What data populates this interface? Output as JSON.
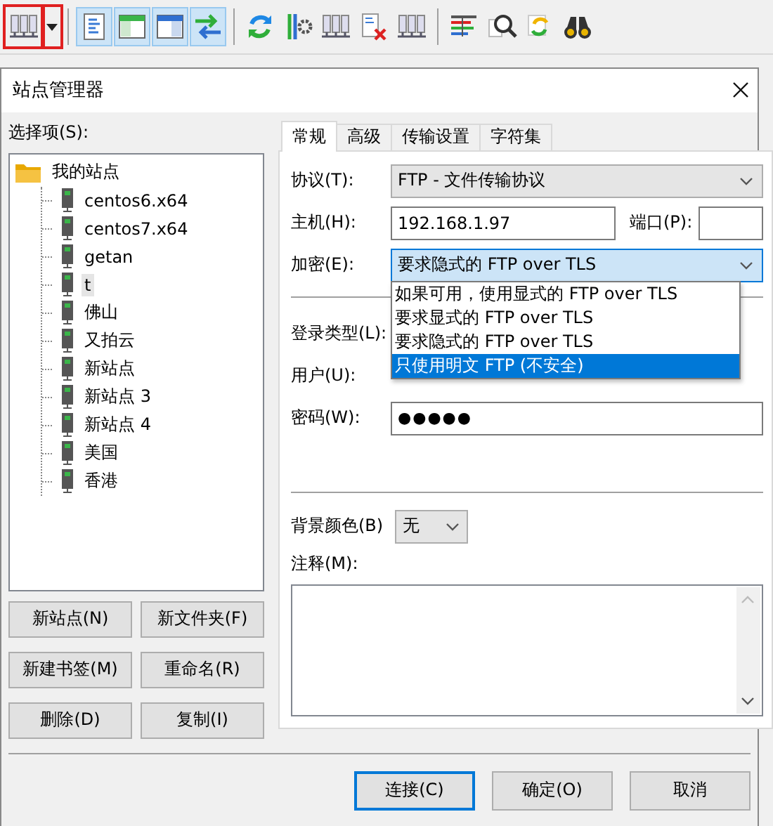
{
  "toolbar": [
    {
      "kind": "server",
      "pressed": false,
      "outlined": true
    },
    {
      "kind": "caret",
      "pressed": false,
      "outlined": true
    },
    {
      "kind": "separator"
    },
    {
      "kind": "document",
      "pressed": true,
      "outlined": false
    },
    {
      "kind": "window-left",
      "pressed": true,
      "outlined": false
    },
    {
      "kind": "window-right",
      "pressed": true,
      "outlined": false
    },
    {
      "kind": "swap",
      "pressed": true,
      "outlined": false
    },
    {
      "kind": "separator"
    },
    {
      "kind": "refresh",
      "pressed": false,
      "outlined": false
    },
    {
      "kind": "sliders",
      "pressed": false,
      "outlined": false
    },
    {
      "kind": "server",
      "pressed": false,
      "outlined": false
    },
    {
      "kind": "file-delete",
      "pressed": false,
      "outlined": false
    },
    {
      "kind": "server",
      "pressed": false,
      "outlined": false
    },
    {
      "kind": "separator"
    },
    {
      "kind": "list",
      "pressed": false,
      "outlined": false
    },
    {
      "kind": "search",
      "pressed": false,
      "outlined": false
    },
    {
      "kind": "sync",
      "pressed": false,
      "outlined": false
    },
    {
      "kind": "binoculars",
      "pressed": false,
      "outlined": false
    }
  ],
  "dialog": {
    "title": "站点管理器",
    "tree_label": "选择项(S):",
    "tree": [
      {
        "label": "我的站点",
        "kind": "folder",
        "selected": false,
        "expanded": true,
        "children": [
          {
            "label": "centos6.x64",
            "kind": "site",
            "selected": false
          },
          {
            "label": "centos7.x64",
            "kind": "site",
            "selected": false
          },
          {
            "label": "getan",
            "kind": "site",
            "selected": false
          },
          {
            "label": "t",
            "kind": "site",
            "selected": true
          },
          {
            "label": "佛山",
            "kind": "site",
            "selected": false
          },
          {
            "label": "又拍云",
            "kind": "site",
            "selected": false
          },
          {
            "label": "新站点",
            "kind": "site",
            "selected": false
          },
          {
            "label": "新站点 3",
            "kind": "site",
            "selected": false
          },
          {
            "label": "新站点 4",
            "kind": "site",
            "selected": false
          },
          {
            "label": "美国",
            "kind": "site",
            "selected": false
          },
          {
            "label": "香港",
            "kind": "site",
            "selected": false
          }
        ]
      }
    ],
    "tree_buttons": [
      "新站点(N)",
      "新文件夹(F)",
      "新建书签(M)",
      "重命名(R)",
      "删除(D)",
      "复制(I)"
    ],
    "tabs": [
      {
        "label": "常规",
        "selected": true
      },
      {
        "label": "高级",
        "selected": false
      },
      {
        "label": "传输设置",
        "selected": false
      },
      {
        "label": "字符集",
        "selected": false
      }
    ],
    "protocol": {
      "label": "协议(T):",
      "value": "FTP - 文件传输协议"
    },
    "host": {
      "label": "主机(H):",
      "value": "192.168.1.97"
    },
    "port": {
      "label": "端口(P):"
    },
    "encryption": {
      "label": "加密(E):",
      "value": "要求隐式的 FTP over TLS",
      "expanded": true,
      "options": [
        {
          "label": "如果可用，使用显式的 FTP over TLS",
          "highlighted": false
        },
        {
          "label": "要求显式的 FTP over TLS",
          "highlighted": false
        },
        {
          "label": "要求隐式的 FTP over TLS",
          "highlighted": false
        },
        {
          "label": "只使用明文 FTP (不安全)",
          "highlighted": true
        }
      ]
    },
    "login_type": {
      "label": "登录类型(L):"
    },
    "user": {
      "label": "用户(U):"
    },
    "password": {
      "label": "密码(W):",
      "value": "●●●●●"
    },
    "background_color": {
      "label": "背景颜色(B)",
      "value": "无"
    },
    "comments": {
      "label": "注释(M):"
    },
    "buttons": [
      {
        "label": "连接(C)",
        "default": true
      },
      {
        "label": "确定(O)",
        "default": false
      },
      {
        "label": "取消",
        "default": false
      }
    ]
  }
}
